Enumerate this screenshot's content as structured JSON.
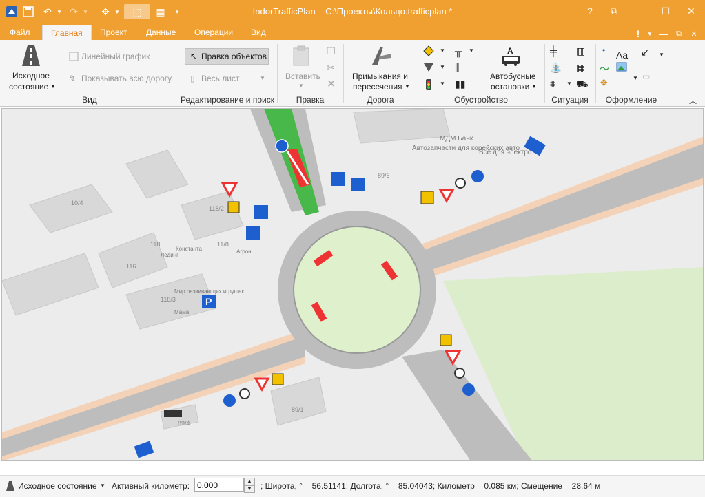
{
  "app": {
    "title": "IndorTrafficPlan – C:\\Проекты\\Кольцо.trafficplan *",
    "window_buttons": {
      "help": "?",
      "restore": "⧉",
      "minimize": "—",
      "maximize": "☐",
      "close": "✕"
    }
  },
  "tabs": [
    {
      "label": "Файл"
    },
    {
      "label": "Главная",
      "active": true
    },
    {
      "label": "Проект"
    },
    {
      "label": "Данные"
    },
    {
      "label": "Операции"
    },
    {
      "label": "Вид"
    }
  ],
  "ribbon": {
    "view_group": {
      "initial_state_line1": "Исходное",
      "initial_state_line2": "состояние",
      "linear_graph": "Линейный график",
      "show_whole_road": "Показывать всю дорогу",
      "label": "Вид"
    },
    "edit_group": {
      "edit_objects": "Правка объектов",
      "whole_sheet": "Весь лист",
      "label": "Редактирование и поиск"
    },
    "clipboard_group": {
      "paste": "Вставить",
      "label": "Правка"
    },
    "road_group": {
      "junctions_line1": "Примыкания и",
      "junctions_line2": "пересечения",
      "label": "Дорога"
    },
    "equipment_group": {
      "bus_stops_line1": "Автобусные",
      "bus_stops_line2": "остановки",
      "label": "Обустройство"
    },
    "situation_group": {
      "label": "Ситуация"
    },
    "design_group": {
      "text_icon": "Aa",
      "label": "Оформление"
    }
  },
  "map": {
    "poi": [
      {
        "label": "МДМ Банк"
      },
      {
        "label": "Автозапчасти для корейских авто"
      },
      {
        "label": "Всё для электро"
      },
      {
        "label": "Константа"
      },
      {
        "label": "Лединг"
      },
      {
        "label": "Мир развивающих игрушек"
      },
      {
        "label": "Мама"
      },
      {
        "label": "Агрон"
      }
    ],
    "buildings": [
      "10/4",
      "118/2",
      "118",
      "116",
      "11/8",
      "118/3",
      "89/1",
      "89/4",
      "89/6"
    ]
  },
  "statusbar": {
    "state_label": "Исходное состояние",
    "active_km_label": "Активный километр:",
    "active_km_value": "0.000",
    "coords": "; Широта, ° = 56.51141; Долгота, ° = 85.04043; Километр = 0.085 км; Смещение = 28.64 м"
  }
}
